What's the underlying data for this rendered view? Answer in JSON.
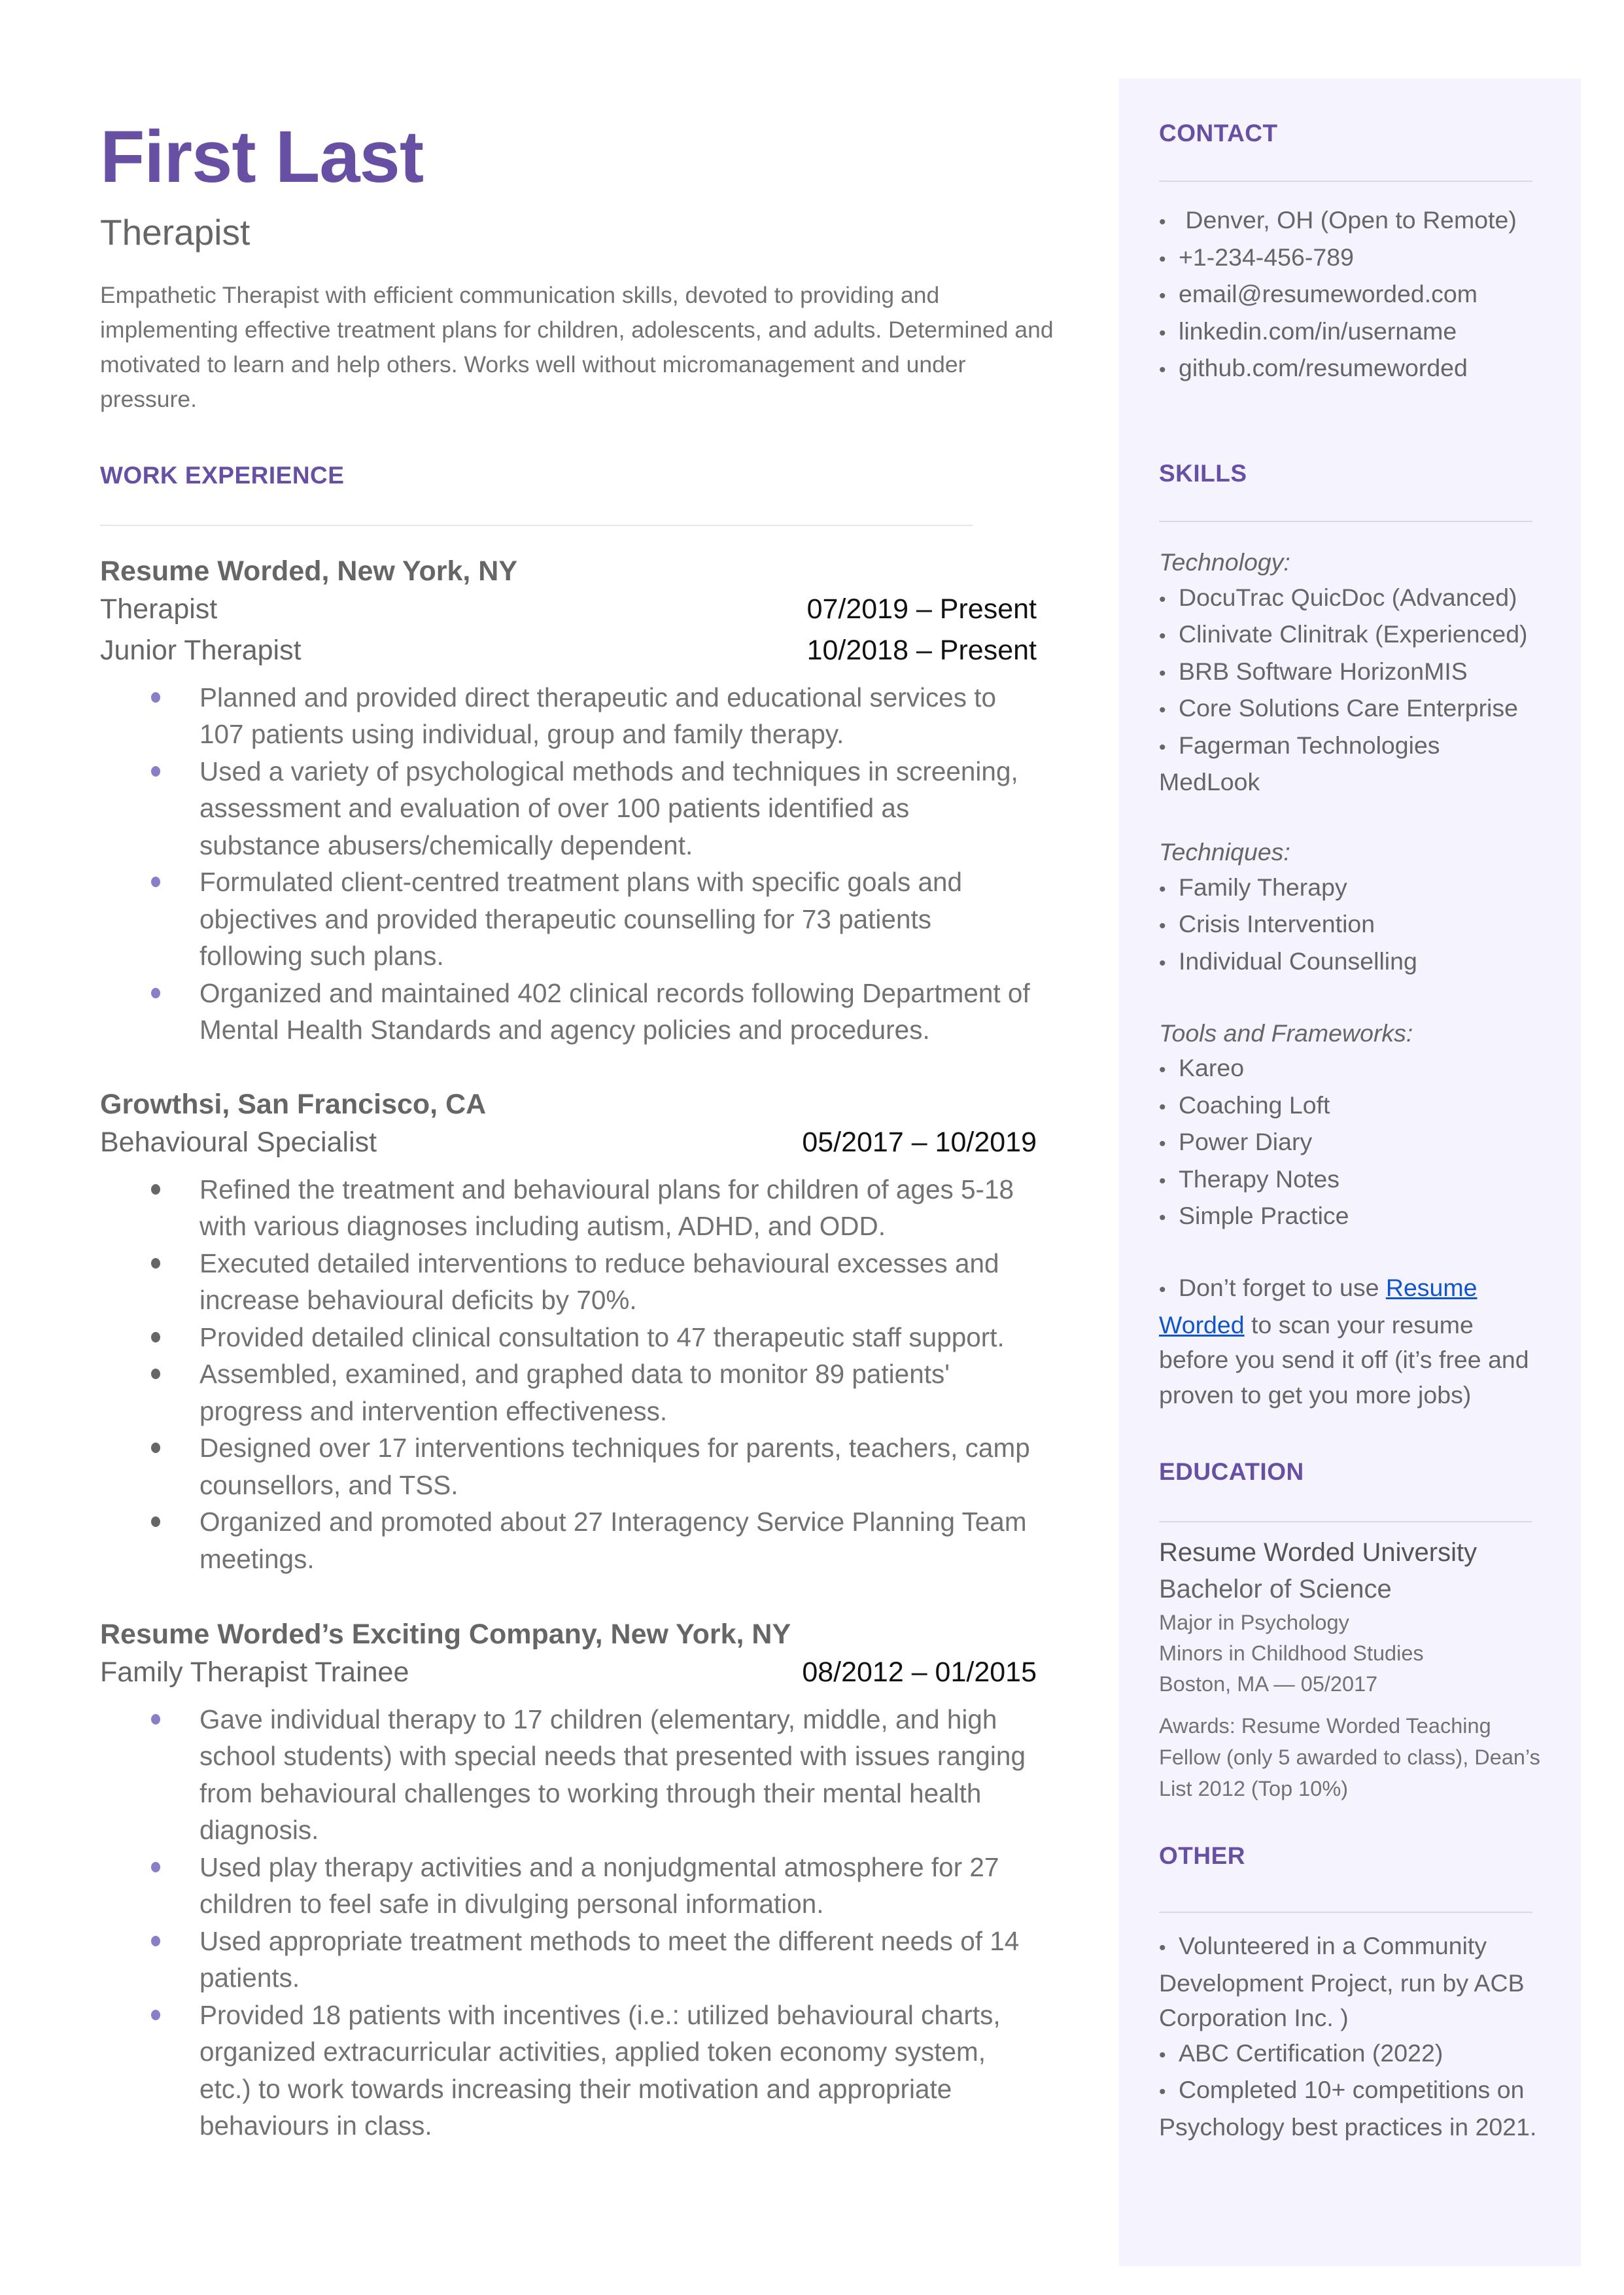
{
  "header": {
    "name": "First Last",
    "title": "Therapist",
    "summary": "Empathetic Therapist with efficient communication skills, devoted to providing and implementing effective treatment plans for children, adolescents, and adults. Determined and motivated to learn and help others. Works well without micromanagement and under pressure."
  },
  "colors": {
    "accent": "#6750a4",
    "sidebar_bg": "#f5f3fe",
    "bullet_purple": "#8a7ec8",
    "link": "#1155cc"
  },
  "work": {
    "heading": "WORK EXPERIENCE",
    "jobs": [
      {
        "company": "Resume Worded, New York, NY",
        "roles": [
          {
            "title": "Therapist",
            "dates": "07/2019 – Present"
          },
          {
            "title": "Junior Therapist",
            "dates": "10/2018 – Present"
          }
        ],
        "bullets": [
          "Planned and provided direct therapeutic and educational services to 107 patients using individual, group and family therapy.",
          "Used a variety of psychological methods and techniques in screening, assessment and evaluation of over 100 patients identified as substance abusers/chemically dependent.",
          "Formulated client-centred treatment plans with specific goals and objectives and provided therapeutic counselling for 73 patients following such plans.",
          "Organized and maintained 402 clinical records following Department of Mental Health Standards and agency policies and procedures."
        ]
      },
      {
        "company": "Growthsi, San Francisco, CA",
        "roles": [
          {
            "title": "Behavioural Specialist",
            "dates": "05/2017 – 10/2019"
          }
        ],
        "bullets": [
          "Refined the treatment and behavioural plans for children of ages 5-18 with various diagnoses including autism, ADHD, and ODD.",
          "Executed detailed interventions to reduce behavioural excesses and increase behavioural deficits by 70%.",
          "Provided detailed clinical consultation to 47 therapeutic staff support.",
          "Assembled, examined, and graphed data to monitor 89 patients' progress and intervention effectiveness.",
          "Designed over 17 interventions techniques for parents, teachers, camp counsellors, and TSS.",
          "Organized and promoted about  27 Interagency Service Planning Team meetings."
        ]
      },
      {
        "company": "Resume Worded’s Exciting Company, New York, NY",
        "roles": [
          {
            "title": "Family Therapist Trainee",
            "dates": "08/2012 – 01/2015"
          }
        ],
        "bullets": [
          "Gave individual therapy to 17 children (elementary, middle, and high school students) with special needs that presented with issues ranging from behavioural challenges to working through their mental health diagnosis.",
          "Used play therapy activities and a nonjudgmental atmosphere for 27 children to feel safe in divulging personal information.",
          "Used appropriate treatment methods to meet the different needs of 14 patients.",
          "Provided 18 patients with incentives (i.e.: utilized behavioural charts, organized extracurricular activities, applied token economy system, etc.) to work towards increasing their motivation and appropriate behaviours in class."
        ]
      }
    ]
  },
  "contact": {
    "heading": "CONTACT",
    "items": [
      " Denver, OH (Open to Remote)",
      "+1-234-456-789",
      "email@resumeworded.com",
      "linkedin.com/in/username",
      "github.com/resumeworded"
    ]
  },
  "skills": {
    "heading": "SKILLS",
    "groups": [
      {
        "label": "Technology:",
        "items": [
          "DocuTrac QuicDoc (Advanced)",
          "Clinivate Clinitrak (Experienced)",
          "BRB Software HorizonMIS",
          "Core Solutions Care Enterprise",
          "Fagerman Technologies MedLook"
        ]
      },
      {
        "label": "Techniques:",
        "items": [
          "Family Therapy",
          "Crisis Intervention",
          "Individual Counselling"
        ]
      },
      {
        "label": "Tools and Frameworks:",
        "items": [
          "Kareo",
          "Coaching Loft",
          "Power Diary",
          "Therapy Notes",
          "Simple Practice"
        ]
      }
    ],
    "tip": {
      "before": "Don’t forget to use ",
      "link": "Resume Worded",
      "after": " to scan your resume before you send it off (it’s free and proven to get you more jobs)"
    }
  },
  "education": {
    "heading": "EDUCATION",
    "school": "Resume Worded University",
    "degree": "Bachelor of Science",
    "major": "Major in Psychology",
    "minor": "Minors in Childhood Studies",
    "location_date": "Boston, MA — 05/2017",
    "awards": "Awards: Resume Worded Teaching Fellow (only 5 awarded to class), Dean’s List 2012 (Top 10%)"
  },
  "other": {
    "heading": "OTHER",
    "items": [
      "Volunteered in a Community Development Project, run by ACB Corporation Inc. )",
      "ABC Certification (2022)",
      "Completed 10+ competitions on Psychology best practices  in 2021."
    ]
  }
}
